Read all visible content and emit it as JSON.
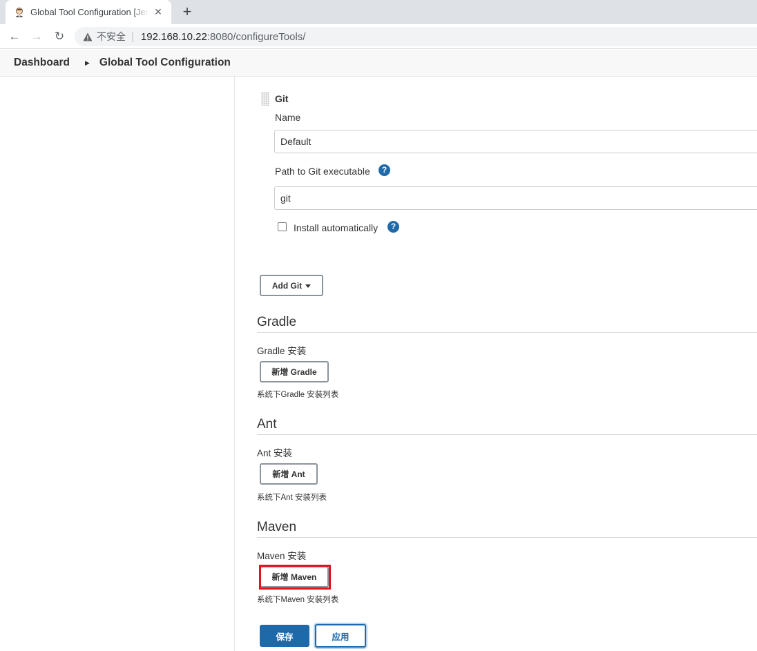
{
  "browser": {
    "tab_title": "Global Tool Configuration [Jenkins]",
    "tab_close": "✕",
    "new_tab": "+",
    "back": "←",
    "forward": "→",
    "reload": "↻",
    "security_label": "不安全",
    "url_host": "192.168.10.22",
    "url_path": ":8080/configureTools/"
  },
  "breadcrumb": {
    "items": [
      "Dashboard",
      "Global Tool Configuration"
    ],
    "separator": "▶"
  },
  "git": {
    "title": "Git",
    "name_label": "Name",
    "name_value": "Default",
    "path_label": "Path to Git executable",
    "path_value": "git",
    "install_auto_label": "Install automatically",
    "install_auto_checked": false,
    "add_button": "Add Git"
  },
  "help_icon": "?",
  "sections": {
    "gradle": {
      "title": "Gradle",
      "install_label": "Gradle 安装",
      "add_button": "新增 Gradle",
      "hint": "系统下Gradle 安装列表"
    },
    "ant": {
      "title": "Ant",
      "install_label": "Ant 安装",
      "add_button": "新增 Ant",
      "hint": "系统下Ant 安装列表"
    },
    "maven": {
      "title": "Maven",
      "install_label": "Maven 安装",
      "add_button": "新增 Maven",
      "hint": "系统下Maven 安装列表"
    }
  },
  "actions": {
    "save": "保存",
    "apply": "应用"
  },
  "colors": {
    "primary": "#1e69a9",
    "highlight": "#e0141e"
  }
}
